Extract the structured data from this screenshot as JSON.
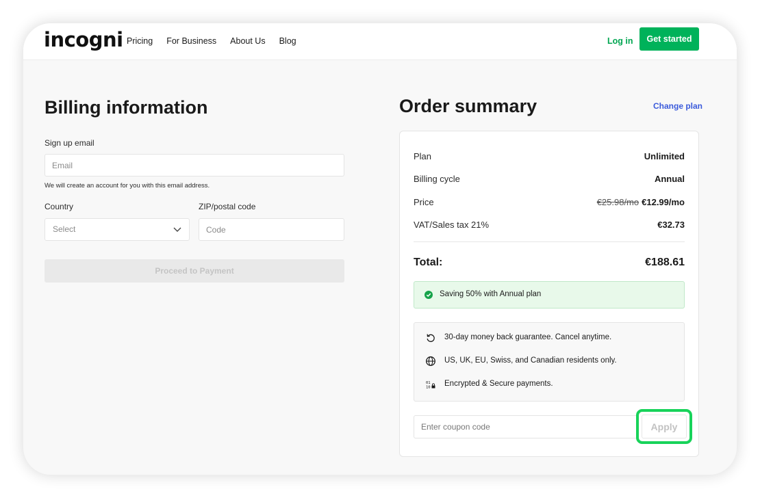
{
  "header": {
    "logo": "incogni",
    "nav": [
      "Pricing",
      "For Business",
      "About Us",
      "Blog"
    ],
    "login": "Log in",
    "get_started": "Get started"
  },
  "billing": {
    "title": "Billing information",
    "email_label": "Sign up email",
    "email_placeholder": "Email",
    "email_hint": "We will create an account for you with this email address.",
    "country_label": "Country",
    "country_value": "Select",
    "zip_label": "ZIP/postal code",
    "zip_placeholder": "Code",
    "proceed": "Proceed to Payment"
  },
  "order": {
    "title": "Order summary",
    "change_plan": "Change plan",
    "rows": [
      {
        "label": "Plan",
        "value": "Unlimited"
      },
      {
        "label": "Billing cycle",
        "value": "Annual"
      },
      {
        "label": "Price",
        "old_value": "€25.98/mo",
        "value": "€12.99/mo"
      },
      {
        "label": "VAT/Sales tax 21%",
        "value": "€32.73"
      }
    ],
    "total_label": "Total:",
    "total_value": "€188.61",
    "saving": "Saving 50% with Annual plan",
    "features": [
      {
        "icon": "refresh-icon",
        "text": "30-day money back guarantee. Cancel anytime."
      },
      {
        "icon": "globe-icon",
        "text": "US, UK, EU, Swiss, and Canadian residents only."
      },
      {
        "icon": "encrypted-icon",
        "text": "Encrypted & Secure payments."
      }
    ],
    "coupon_placeholder": "Enter coupon code",
    "apply": "Apply"
  },
  "colors": {
    "brand_green": "#00b25a",
    "link_blue": "#3b5bdb",
    "highlight_ring": "#18d35a",
    "saving_bg": "#e8f9ea"
  }
}
